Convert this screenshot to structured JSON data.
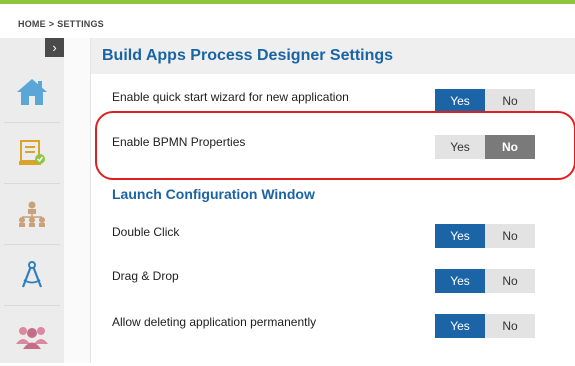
{
  "breadcrumb": {
    "home": "HOME",
    "separator": ">",
    "current": "SETTINGS"
  },
  "sidebar": {
    "collapse_glyph": "›",
    "items": [
      {
        "icon": "home-icon"
      },
      {
        "icon": "form-check-icon"
      },
      {
        "icon": "org-chart-icon"
      },
      {
        "icon": "compass-icon"
      },
      {
        "icon": "users-group-icon"
      }
    ]
  },
  "page": {
    "title": "Build Apps Process Designer Settings",
    "launch_section_title": "Launch Configuration Window"
  },
  "settings": [
    {
      "label": "Enable quick start wizard for new application",
      "yes": "Yes",
      "no": "No",
      "value": "Yes"
    },
    {
      "label": "Enable BPMN Properties",
      "yes": "Yes",
      "no": "No",
      "value": "No"
    },
    {
      "label": "Double Click",
      "yes": "Yes",
      "no": "No",
      "value": "Yes"
    },
    {
      "label": "Drag & Drop",
      "yes": "Yes",
      "no": "No",
      "value": "Yes"
    },
    {
      "label": "Allow deleting application permanently",
      "yes": "Yes",
      "no": "No",
      "value": "Yes"
    }
  ],
  "colors": {
    "accent_green": "#8dc63f",
    "brand_blue": "#1b65a6",
    "highlight_red": "#e02020"
  }
}
